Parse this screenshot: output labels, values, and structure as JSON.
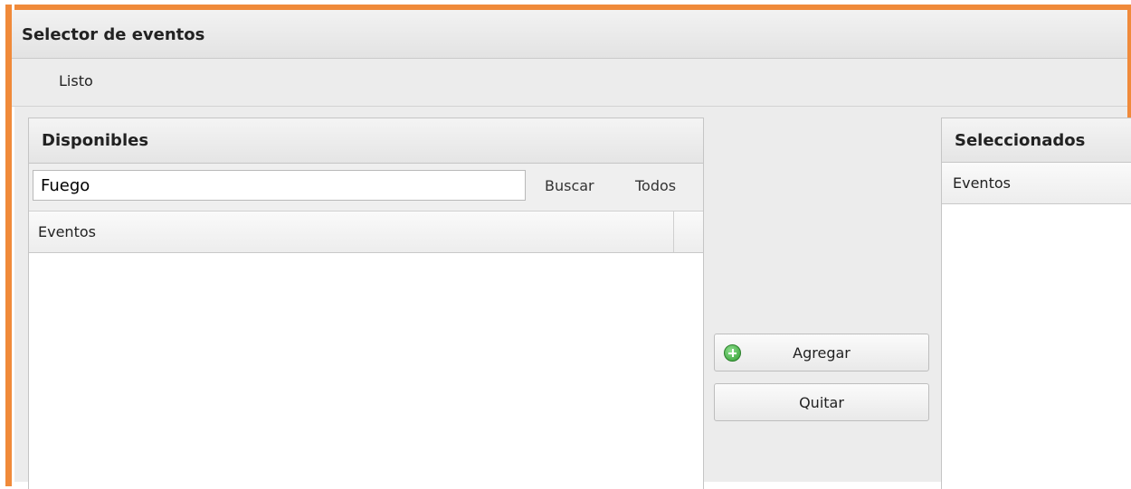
{
  "window": {
    "title": "Selector de eventos"
  },
  "toolbar": {
    "done_label": "Listo"
  },
  "available": {
    "title": "Disponibles",
    "search_value": "Fuego",
    "search_label": "Buscar",
    "all_label": "Todos",
    "column_header": "Eventos"
  },
  "actions": {
    "add_label": "Agregar",
    "remove_label": "Quitar",
    "add_icon": "plus-circle-icon"
  },
  "selected": {
    "title": "Seleccionados",
    "column_header": "Eventos"
  },
  "colors": {
    "frame_accent": "#f08a3a",
    "add_icon_green": "#2f9b2f"
  }
}
